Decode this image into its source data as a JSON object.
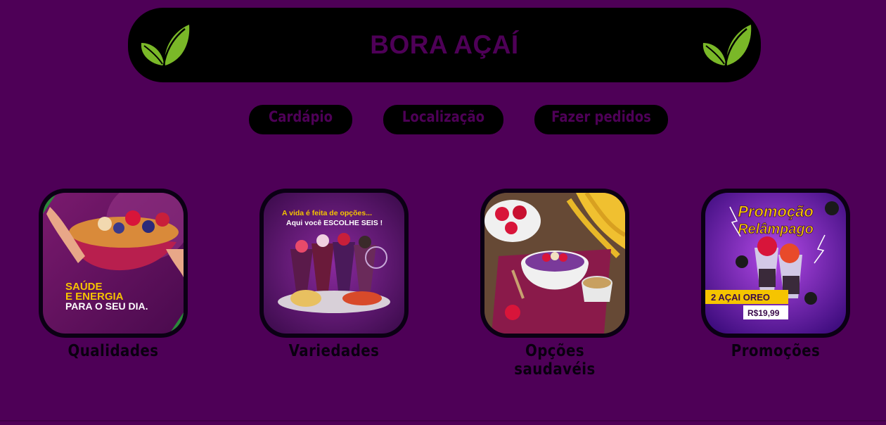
{
  "header": {
    "title": "BORA AÇAÍ",
    "left_icon": "leaf-icon",
    "right_icon": "leaf-icon"
  },
  "nav": {
    "items": [
      {
        "label": "Cardápio"
      },
      {
        "label": "Localização"
      },
      {
        "label": "Fazer pedidos"
      }
    ]
  },
  "cards": [
    {
      "label": "Qualidades",
      "image_text": [
        "SAÚDE",
        "E ENERGIA",
        "PARA O SEU DIA."
      ]
    },
    {
      "label": "Variedades",
      "image_text": [
        "A vida é feita de opções...",
        "Aqui você ESCOLHE SEIS !"
      ]
    },
    {
      "label": "Opções saudavéis"
    },
    {
      "label": "Promoções",
      "image_text": [
        "Promoção",
        "Relâmpago",
        "2 AÇAI OREO",
        "R$19,99"
      ]
    }
  ],
  "colors": {
    "background": "#4e0057",
    "header_bg": "#000000",
    "header_text": "#4e0057",
    "leaf": "#7ab828",
    "button_bg": "#000000",
    "label_text": "#0a0010"
  }
}
